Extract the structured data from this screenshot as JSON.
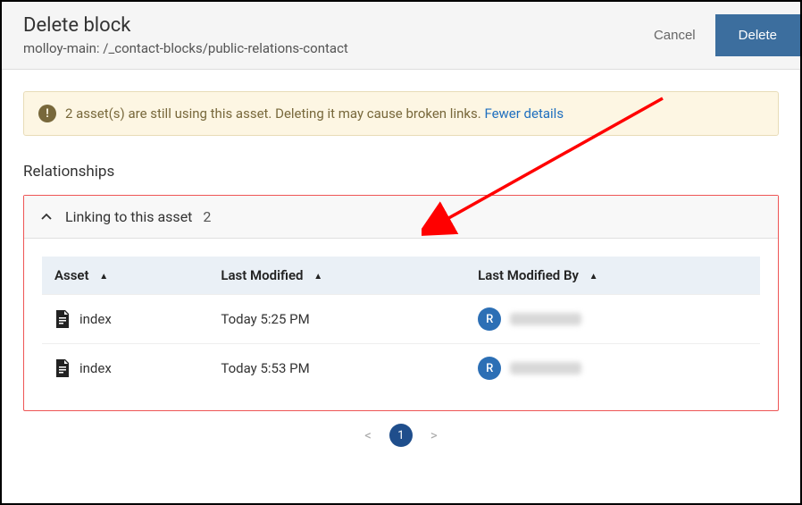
{
  "header": {
    "title": "Delete block",
    "subtitle": "molloy-main: /_contact-blocks/public-relations-contact",
    "cancel_label": "Cancel",
    "delete_label": "Delete"
  },
  "warning": {
    "icon_glyph": "!",
    "text": "2 asset(s) are still using this asset. Deleting it may cause broken links.",
    "link_label": "Fewer details"
  },
  "section": {
    "title": "Relationships"
  },
  "panel": {
    "title": "Linking to this asset",
    "count": "2"
  },
  "table": {
    "columns": {
      "asset": "Asset",
      "last_modified": "Last Modified",
      "last_modified_by": "Last Modified By"
    },
    "rows": [
      {
        "asset": "index",
        "last_modified": "Today 5:25 PM",
        "avatar_initial": "R"
      },
      {
        "asset": "index",
        "last_modified": "Today 5:53 PM",
        "avatar_initial": "R"
      }
    ]
  },
  "pagination": {
    "prev": "<",
    "current": "1",
    "next": ">"
  }
}
